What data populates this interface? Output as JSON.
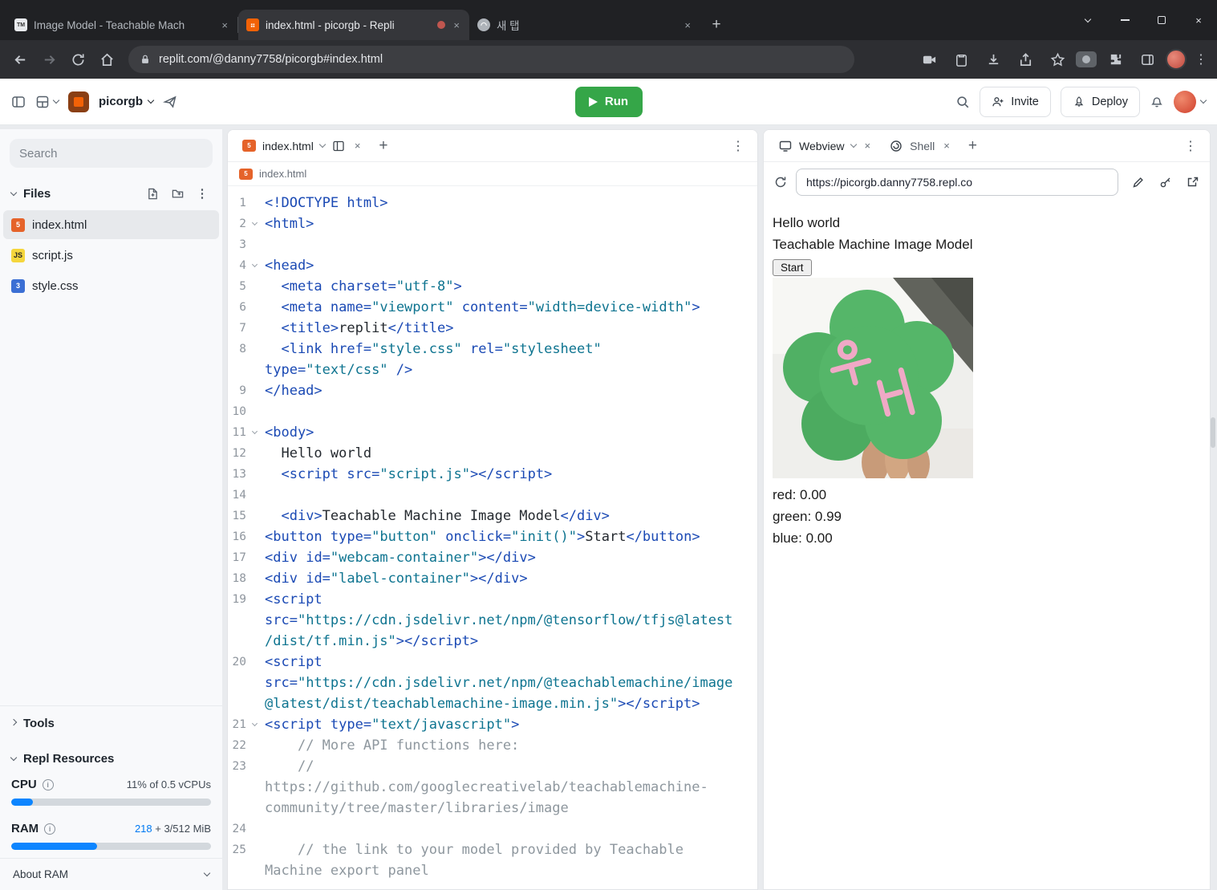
{
  "browser": {
    "tabs": [
      {
        "title": "Image Model - Teachable Mach"
      },
      {
        "title": "index.html - picorgb - Repli"
      },
      {
        "title": "새 탭"
      }
    ],
    "url": "replit.com/@danny7758/picorgb#index.html"
  },
  "header": {
    "project_name": "picorgb",
    "run_label": "Run",
    "invite_label": "Invite",
    "deploy_label": "Deploy"
  },
  "sidebar": {
    "search_placeholder": "Search",
    "files_title": "Files",
    "files": [
      {
        "name": "index.html",
        "type": "html"
      },
      {
        "name": "script.js",
        "type": "js"
      },
      {
        "name": "style.css",
        "type": "css"
      }
    ],
    "tools_title": "Tools",
    "resources": {
      "title": "Repl Resources",
      "cpu": {
        "label": "CPU",
        "value": "11% of 0.5 vCPUs",
        "percent": 11
      },
      "ram": {
        "label": "RAM",
        "used": "218",
        "rest": " + 3/512 MiB",
        "percent": 43
      },
      "about_ram": "About RAM"
    }
  },
  "editor": {
    "tab": "index.html",
    "breadcrumb": "index.html",
    "lines": [
      {
        "n": 1,
        "fold": false,
        "tokens": [
          [
            "tag",
            "<!DOCTYPE html>"
          ]
        ]
      },
      {
        "n": 2,
        "fold": true,
        "tokens": [
          [
            "tag",
            "<html>"
          ]
        ]
      },
      {
        "n": 3,
        "fold": false,
        "tokens": []
      },
      {
        "n": 4,
        "fold": true,
        "tokens": [
          [
            "tag",
            "<head>"
          ]
        ]
      },
      {
        "n": 5,
        "fold": false,
        "tokens": [
          [
            "plain",
            "  "
          ],
          [
            "tag",
            "<meta"
          ],
          [
            "plain",
            " "
          ],
          [
            "attr",
            "charset="
          ],
          [
            "str",
            "\"utf-8\""
          ],
          [
            "tag",
            ">"
          ]
        ]
      },
      {
        "n": 6,
        "fold": false,
        "tokens": [
          [
            "plain",
            "  "
          ],
          [
            "tag",
            "<meta"
          ],
          [
            "plain",
            " "
          ],
          [
            "attr",
            "name="
          ],
          [
            "str",
            "\"viewport\""
          ],
          [
            "plain",
            " "
          ],
          [
            "attr",
            "content="
          ],
          [
            "str",
            "\"width=device-width\""
          ],
          [
            "tag",
            ">"
          ]
        ]
      },
      {
        "n": 7,
        "fold": false,
        "tokens": [
          [
            "plain",
            "  "
          ],
          [
            "tag",
            "<title>"
          ],
          [
            "plain",
            "replit"
          ],
          [
            "tag",
            "</title>"
          ]
        ]
      },
      {
        "n": 8,
        "fold": false,
        "tokens": [
          [
            "plain",
            "  "
          ],
          [
            "tag",
            "<link"
          ],
          [
            "plain",
            " "
          ],
          [
            "attr",
            "href="
          ],
          [
            "str",
            "\"style.css\""
          ],
          [
            "plain",
            " "
          ],
          [
            "attr",
            "rel="
          ],
          [
            "str",
            "\"stylesheet\""
          ],
          [
            "plain",
            "\n"
          ],
          [
            "attr",
            "type="
          ],
          [
            "str",
            "\"text/css\""
          ],
          [
            "plain",
            " "
          ],
          [
            "tag",
            "/>"
          ]
        ]
      },
      {
        "n": 9,
        "fold": false,
        "tokens": [
          [
            "tag",
            "</head>"
          ]
        ]
      },
      {
        "n": 10,
        "fold": false,
        "tokens": []
      },
      {
        "n": 11,
        "fold": true,
        "tokens": [
          [
            "tag",
            "<body>"
          ]
        ]
      },
      {
        "n": 12,
        "fold": false,
        "tokens": [
          [
            "plain",
            "  Hello world"
          ]
        ]
      },
      {
        "n": 13,
        "fold": false,
        "tokens": [
          [
            "plain",
            "  "
          ],
          [
            "tag",
            "<script"
          ],
          [
            "plain",
            " "
          ],
          [
            "attr",
            "src="
          ],
          [
            "str",
            "\"script.js\""
          ],
          [
            "tag",
            "></script>"
          ]
        ]
      },
      {
        "n": 14,
        "fold": false,
        "tokens": []
      },
      {
        "n": 15,
        "fold": false,
        "tokens": [
          [
            "plain",
            "  "
          ],
          [
            "tag",
            "<div>"
          ],
          [
            "plain",
            "Teachable Machine Image Model"
          ],
          [
            "tag",
            "</div>"
          ]
        ]
      },
      {
        "n": 16,
        "fold": false,
        "tokens": [
          [
            "tag",
            "<button"
          ],
          [
            "plain",
            " "
          ],
          [
            "attr",
            "type="
          ],
          [
            "str",
            "\"button\""
          ],
          [
            "plain",
            " "
          ],
          [
            "attr",
            "onclick="
          ],
          [
            "str",
            "\"init()\""
          ],
          [
            "tag",
            ">"
          ],
          [
            "plain",
            "Start"
          ],
          [
            "tag",
            "</button>"
          ]
        ]
      },
      {
        "n": 17,
        "fold": false,
        "tokens": [
          [
            "tag",
            "<div"
          ],
          [
            "plain",
            " "
          ],
          [
            "attr",
            "id="
          ],
          [
            "str",
            "\"webcam-container\""
          ],
          [
            "tag",
            "></div>"
          ]
        ]
      },
      {
        "n": 18,
        "fold": false,
        "tokens": [
          [
            "tag",
            "<div"
          ],
          [
            "plain",
            " "
          ],
          [
            "attr",
            "id="
          ],
          [
            "str",
            "\"label-container\""
          ],
          [
            "tag",
            "></div>"
          ]
        ]
      },
      {
        "n": 19,
        "fold": false,
        "tokens": [
          [
            "tag",
            "<script"
          ],
          [
            "plain",
            "\n"
          ],
          [
            "attr",
            "src="
          ],
          [
            "str",
            "\"https://cdn.jsdelivr.net/npm/@tensorflow/tfjs@latest"
          ],
          [
            "plain",
            "\n"
          ],
          [
            "str",
            "/dist/tf.min.js\""
          ],
          [
            "tag",
            "></script>"
          ]
        ]
      },
      {
        "n": 20,
        "fold": false,
        "tokens": [
          [
            "tag",
            "<script"
          ],
          [
            "plain",
            "\n"
          ],
          [
            "attr",
            "src="
          ],
          [
            "str",
            "\"https://cdn.jsdelivr.net/npm/@teachablemachine/image"
          ],
          [
            "plain",
            "\n"
          ],
          [
            "str",
            "@latest/dist/teachablemachine-image.min.js\""
          ],
          [
            "tag",
            "></script>"
          ]
        ]
      },
      {
        "n": 21,
        "fold": true,
        "tokens": [
          [
            "tag",
            "<script"
          ],
          [
            "plain",
            " "
          ],
          [
            "attr",
            "type="
          ],
          [
            "str",
            "\"text/javascript\""
          ],
          [
            "tag",
            ">"
          ]
        ]
      },
      {
        "n": 22,
        "fold": false,
        "tokens": [
          [
            "comment",
            "    // More API functions here:"
          ]
        ]
      },
      {
        "n": 23,
        "fold": false,
        "tokens": [
          [
            "comment",
            "    //\nhttps://github.com/googlecreativelab/teachablemachine-\ncommunity/tree/master/libraries/image"
          ]
        ]
      },
      {
        "n": 24,
        "fold": false,
        "tokens": []
      },
      {
        "n": 25,
        "fold": false,
        "tokens": [
          [
            "comment",
            "    // the link to your model provided by Teachable\nMachine export panel"
          ]
        ]
      }
    ]
  },
  "webview": {
    "tab": "Webview",
    "shell_tab": "Shell",
    "url": "https://picorgb.danny7758.repl.co",
    "page": {
      "hello": "Hello world",
      "title": "Teachable Machine Image Model",
      "start_label": "Start",
      "outputs": [
        "red: 0.00",
        "green: 0.99",
        "blue: 0.00"
      ]
    }
  },
  "colors": {
    "accent_blue": "#0079f2",
    "run_green": "#35a648",
    "plush_green": "#55b669",
    "plush_text_pink": "#f0a9c6"
  }
}
